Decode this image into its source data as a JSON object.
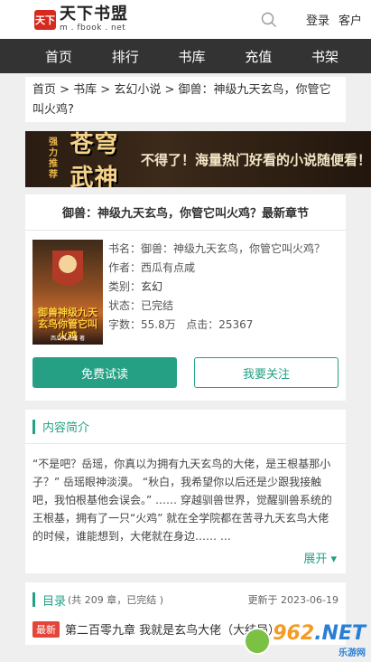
{
  "header": {
    "logo_mark": "天下",
    "logo_name": "天下书盟",
    "logo_url": "m . fbook . net",
    "login": "登录",
    "client": "客户"
  },
  "nav": [
    "首页",
    "排行",
    "书库",
    "充值",
    "书架"
  ],
  "breadcrumb": "首页 > 书库 > 玄幻小说 > 御兽：神级九天玄鸟，你管它叫火鸡?",
  "banner": {
    "badge": "强力推荐",
    "title": "苍穹武神",
    "slogan": "不得了！海量热门好看的小说随便看！"
  },
  "book": {
    "heading": "御兽：神级九天玄鸟，你管它叫火鸡？最新章节",
    "cover_title": "御兽神级九天玄鸟你管它叫火鸡",
    "cover_author": "西瓜有点咸 著",
    "name_label": "书名：",
    "name": "御兽：神级九天玄鸟，你管它叫火鸡？",
    "author_label": "作者：",
    "author": "西瓜有点咸",
    "category_label": "类别：",
    "category": "玄幻",
    "status_label": "状态：",
    "status": "已完结",
    "words_label": "字数：",
    "words": "55.8万",
    "clicks_label": "点击：",
    "clicks": "25367",
    "read_button": "免费试读",
    "follow_button": "我要关注"
  },
  "intro": {
    "title": "内容简介",
    "text": "“不是吧？岳瑶，你真以为拥有九天玄鸟的大佬，是王根基那小子？” 岳瑶眼神淡漠。 “秋白，我希望你以后还是少跟我接触吧，我怕根基他会误会。” …… 穿越驯兽世界，觉醒驯兽系统的王根基，拥有了一只“火鸡” 就在全学院都在苦寻九天玄鸟大佬的时候，谁能想到，大佬就在身边…… …",
    "expand": "展开 ▾"
  },
  "toc": {
    "title": "目录",
    "count": "(共 209 章，已完结 )",
    "updated": "更新于 2023-06-19",
    "new_tag": "最新",
    "latest_chapter": "第二百零九章 我就是玄鸟大佬（大结局）"
  },
  "watermark": {
    "number": "962",
    "suffix": ".NET",
    "sub": "乐游网"
  },
  "colors": {
    "accent": "#25a084",
    "nav_bg": "#333333",
    "new_tag": "#e4453a"
  }
}
